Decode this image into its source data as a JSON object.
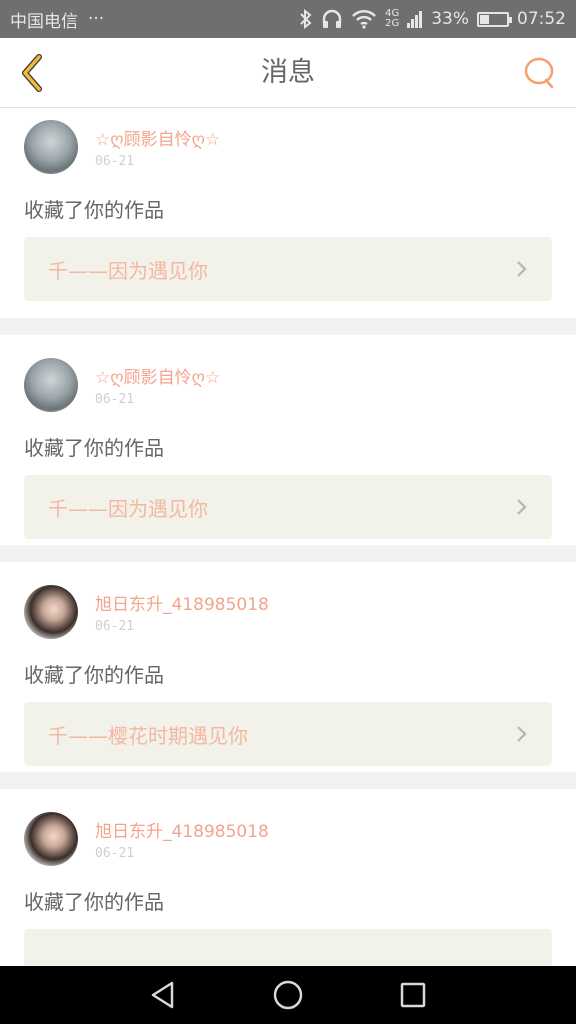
{
  "status_bar": {
    "carrier": "中国电信",
    "more": "···",
    "network_top": "4G",
    "network_bottom": "2G",
    "battery_percent": "33%",
    "battery_level": 0.33,
    "time": "07:52",
    "icons": [
      "bluetooth-icon",
      "headphones-icon",
      "wifi-icon",
      "signal-icon",
      "battery-icon"
    ]
  },
  "nav": {
    "title": "消息",
    "back_icon": "chevron-left-icon",
    "search_icon": "search-icon",
    "accent": "#f2b93b",
    "search_color": "#f4a06a"
  },
  "messages": [
    {
      "user": "☆ღ顾影自怜ღ☆",
      "date": "06-21",
      "action": "收藏了你的作品",
      "work": "千——因为遇见你"
    },
    {
      "user": "☆ღ顾影自怜ღ☆",
      "date": "06-21",
      "action": "收藏了你的作品",
      "work": "千——因为遇见你"
    },
    {
      "user": "旭日东升_418985018",
      "date": "06-21",
      "action": "收藏了你的作品",
      "work": "千——樱花时期遇见你"
    },
    {
      "user": "旭日东升_418985018",
      "date": "06-21",
      "action": "收藏了你的作品",
      "work": ""
    }
  ],
  "colors": {
    "username": "#f4a48c",
    "work_title": "#f4b8a2",
    "work_box_bg": "#f2f2ea"
  }
}
